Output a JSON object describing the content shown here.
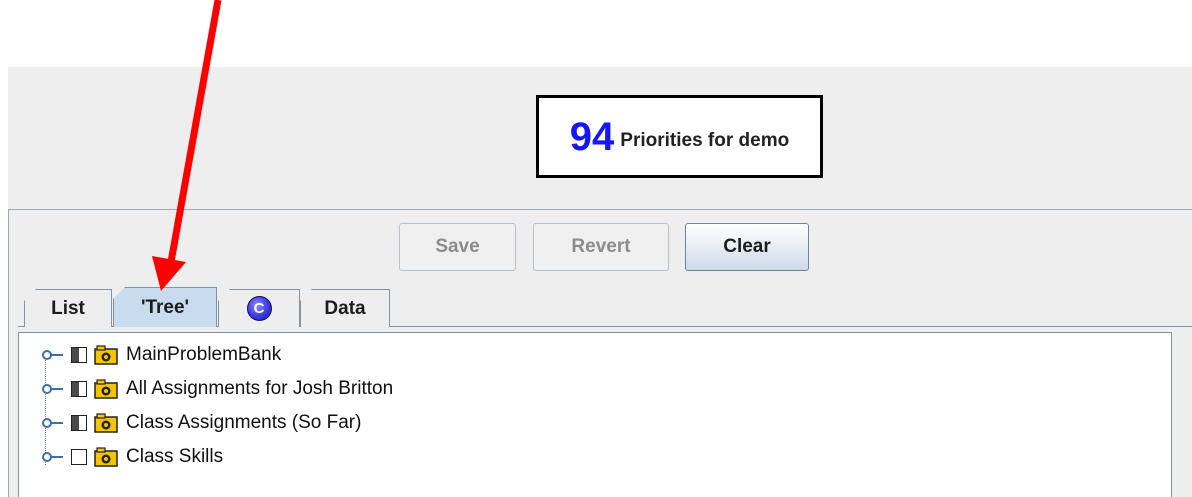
{
  "header": {
    "count": "94",
    "count_label": "Priorities for demo"
  },
  "toolbar": {
    "save_label": "Save",
    "revert_label": "Revert",
    "clear_label": "Clear"
  },
  "tabs": [
    {
      "label": "List",
      "selected": false
    },
    {
      "label": "'Tree'",
      "selected": true
    },
    {
      "label": "C",
      "selected": false,
      "icon": "c-circle-icon"
    },
    {
      "label": "Data",
      "selected": false
    }
  ],
  "tree": {
    "items": [
      {
        "label": "MainProblemBank",
        "icon": "folder-icon"
      },
      {
        "label": "All Assignments for Josh Britton",
        "icon": "folder-icon"
      },
      {
        "label": "Class Assignments (So Far)",
        "icon": "folder-icon"
      },
      {
        "label": "Class Skills",
        "icon": "folder-icon"
      }
    ]
  },
  "colors": {
    "count_number": "#1515ff",
    "annotation_arrow": "#ff0000",
    "selected_tab": "#c9dcef"
  }
}
